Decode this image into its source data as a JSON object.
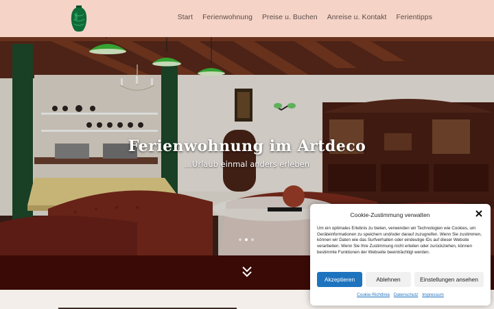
{
  "header": {
    "logo_icon": "green-vase-logo",
    "nav": [
      {
        "label": "Start"
      },
      {
        "label": "Ferienwohnung"
      },
      {
        "label": "Preise u. Buchen"
      },
      {
        "label": "Anreise u. Kontakt"
      },
      {
        "label": "Ferientipps"
      }
    ]
  },
  "hero": {
    "title": "Ferienwohnung im Artdeco",
    "subtitle": "...Urlaub einmal anders erleben",
    "slider_dots": 3,
    "active_dot": 2
  },
  "scroll_band": {
    "icon": "double-chevron-down-icon",
    "color": "#3a0a06"
  },
  "cookie": {
    "title": "Cookie-Zustimmung verwalten",
    "text": "Um ein optimales Erlebnis zu bieten, verwenden wir Technologien wie Cookies, um Geräteinformationen zu speichern und/oder darauf zuzugreifen. Wenn Sie zustimmen, können wir Daten wie das Surfverhalten oder eindeutige IDs auf dieser Website verarbeiten. Wenn Sie Ihre Zustimmung nicht erteilen oder zurückziehen, können bestimmte Funktionen der Webseite beeinträchtigt werden.",
    "accept_label": "Akzeptieren",
    "deny_label": "Ablehnen",
    "settings_label": "Einstellungen ansehen",
    "links": [
      {
        "label": "Cookie-Richtlinie"
      },
      {
        "label": "Datenschutz"
      },
      {
        "label": "Impressum"
      }
    ],
    "accent_color": "#1e73be"
  },
  "colors": {
    "header_bg": "#f5d3c7",
    "nav_text": "#5a4c48"
  }
}
